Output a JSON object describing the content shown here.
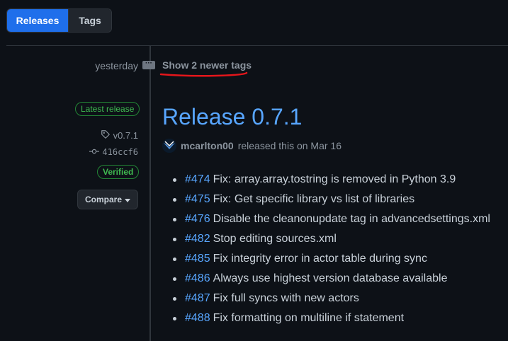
{
  "tabs": {
    "releases": "Releases",
    "tags": "Tags"
  },
  "timeline": {
    "date": "yesterday",
    "show_newer": "Show 2 newer tags"
  },
  "release": {
    "badge": "Latest release",
    "tag": "v0.7.1",
    "commit": "416ccf6",
    "verified": "Verified",
    "compare": "Compare",
    "title": "Release 0.7.1",
    "author": "mcarlton00",
    "released_text": "released this on Mar 16",
    "notes": [
      {
        "pr": "#474",
        "text": "Fix: array.array.tostring is removed in Python 3.9"
      },
      {
        "pr": "#475",
        "text": "Fix: Get specific library vs list of libraries"
      },
      {
        "pr": "#476",
        "text": "Disable the cleanonupdate tag in advancedsettings.xml"
      },
      {
        "pr": "#482",
        "text": "Stop editing sources.xml"
      },
      {
        "pr": "#485",
        "text": "Fix integrity error in actor table during sync"
      },
      {
        "pr": "#486",
        "text": "Always use highest version database available"
      },
      {
        "pr": "#487",
        "text": "Fix full syncs with new actors"
      },
      {
        "pr": "#488",
        "text": "Fix formatting on multiline if statement"
      }
    ]
  },
  "icons": {
    "tag": "tag-icon",
    "commit": "git-commit-icon",
    "caret": "caret-down-icon",
    "avatar": "user-avatar",
    "ellipsis": "ellipsis-icon"
  },
  "colors": {
    "accent": "#1f6feb",
    "link": "#58a6ff",
    "success": "#3fb950",
    "annotation": "#e5161b"
  }
}
